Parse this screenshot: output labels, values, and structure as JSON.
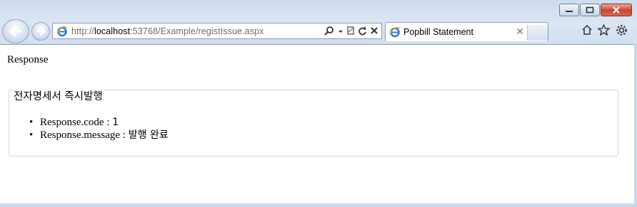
{
  "browser": {
    "address_prefix": "http://",
    "address_host": "localhost",
    "address_rest": ":53768/Example/registIssue.aspx",
    "tab_title": "Popbill Statement",
    "tab_close": "✕",
    "window_buttons": [
      "minimize-icon",
      "maximize-icon",
      "close-icon"
    ]
  },
  "page": {
    "heading": "Response",
    "fieldset_legend": "전자명세서 즉시발행",
    "items": [
      {
        "label": "Response.code",
        "sep": " : ",
        "value": "1"
      },
      {
        "label": "Response.message",
        "sep": " : ",
        "value": "발행 완료"
      }
    ]
  }
}
